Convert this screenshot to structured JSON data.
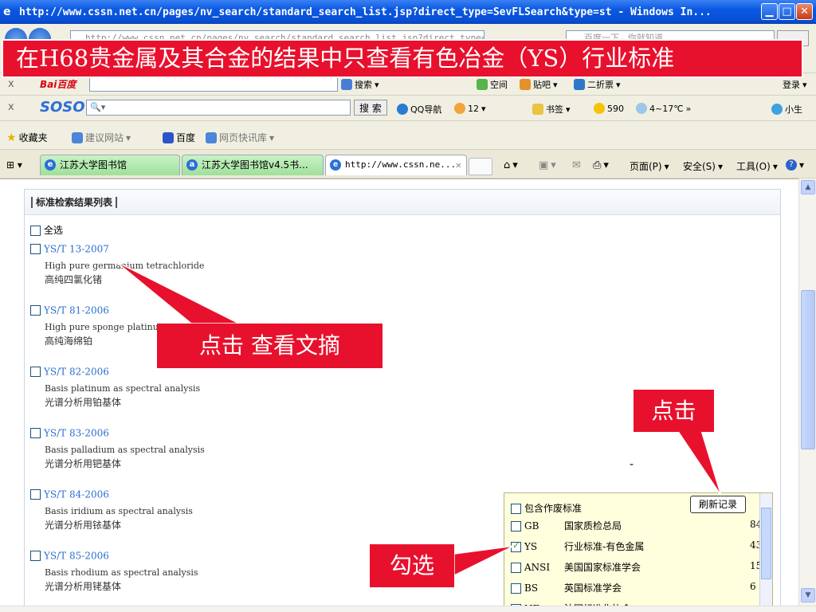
{
  "window": {
    "title": "http://www.cssn.net.cn/pages/nv_search/standard_search_list.jsp?direct_type=SevFLSearch&type=st - Windows In...",
    "url": "http://www.cssn.net.cn/pages/nv_search/standard_search_list.jsp?direct_type=SevFLSearch&type=st",
    "search_placeholder": "百度一下，你就知道"
  },
  "banner": "在H68贵金属及其合金的结果中只查看有色冶金（YS）行业标准",
  "baidu_bar": {
    "logo": "Bai百度",
    "search_label": "搜索",
    "items": [
      "空间",
      "贴吧",
      "二折票",
      "登录"
    ]
  },
  "soso_bar": {
    "logo": "SOSO",
    "search_label": "搜 索",
    "items": [
      "QQ导航",
      "12",
      "书签",
      "590",
      "4~17℃",
      "小生"
    ]
  },
  "favorites_bar": {
    "favorites": "收藏夹",
    "items": [
      "建议网站",
      "百度",
      "网页快讯库"
    ]
  },
  "tabs": [
    {
      "label": "江苏大学图书馆"
    },
    {
      "label": "江苏大学图书馆v4.5书..."
    },
    {
      "label": "http://www.cssn.ne..."
    }
  ],
  "command_bar": {
    "page": "页面(P)",
    "safety": "安全(S)",
    "tools": "工具(O)"
  },
  "results": {
    "heading": "标准检索结果列表",
    "select_all": "全选",
    "items": [
      {
        "code": "YS/T 13-2007",
        "en": "High pure germanium tetrachloride",
        "cn": "高纯四氯化锗"
      },
      {
        "code": "YS/T 81-2006",
        "en": "High pure sponge platinum",
        "cn": "高纯海绵铂"
      },
      {
        "code": "YS/T 82-2006",
        "en": "Basis platinum as spectral analysis",
        "cn": "光谱分析用铂基体"
      },
      {
        "code": "YS/T 83-2006",
        "en": "Basis palladium as spectral analysis",
        "cn": "光谱分析用钯基体"
      },
      {
        "code": "YS/T 84-2006",
        "en": "Basis iridium as spectral analysis",
        "cn": "光谱分析用铱基体"
      },
      {
        "code": "YS/T 85-2006",
        "en": "Basis rhodium as spectral analysis",
        "cn": "光谱分析用铑基体"
      }
    ]
  },
  "filter": {
    "include_obsolete": "包含作废标准",
    "refresh": "刷新记录",
    "dash": "-",
    "rows": [
      {
        "code": "GB",
        "name": "国家质检总局",
        "count": "84",
        "checked": false
      },
      {
        "code": "YS",
        "name": "行业标准-有色金属",
        "count": "43",
        "checked": true
      },
      {
        "code": "ANSI",
        "name": "美国国家标准学会",
        "count": "15",
        "checked": false
      },
      {
        "code": "BS",
        "name": "英国标准学会",
        "count": "6",
        "checked": false
      },
      {
        "code": "NF",
        "name": "法国标准化协会",
        "count": "",
        "checked": false
      }
    ]
  },
  "callouts": {
    "view_abstract": "点击 查看文摘",
    "click": "点击",
    "check": "勾选"
  },
  "colors": {
    "callout": "#e8112d",
    "link": "#2a6fd0",
    "filter_bg": "#ffffdd",
    "titlebar": "#0a58e2"
  }
}
